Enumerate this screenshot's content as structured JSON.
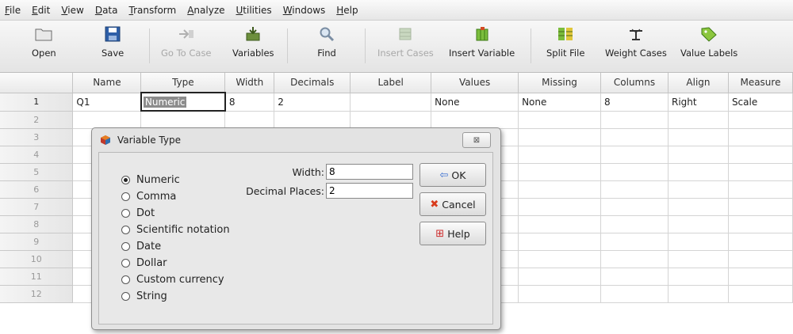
{
  "menu": [
    "File",
    "Edit",
    "View",
    "Data",
    "Transform",
    "Analyze",
    "Utilities",
    "Windows",
    "Help"
  ],
  "toolbar": {
    "open": "Open",
    "save": "Save",
    "go_to_case": "Go To Case",
    "variables": "Variables",
    "find": "Find",
    "insert_cases": "Insert Cases",
    "insert_variable": "Insert Variable",
    "split_file": "Split File",
    "weight_cases": "Weight Cases",
    "value_labels": "Value Labels"
  },
  "grid": {
    "columns": [
      "Name",
      "Type",
      "Width",
      "Decimals",
      "Label",
      "Values",
      "Missing",
      "Columns",
      "Align",
      "Measure"
    ],
    "row_numbers": [
      "1",
      "2",
      "3",
      "4",
      "5",
      "6",
      "7",
      "8",
      "9",
      "10",
      "11",
      "12"
    ],
    "row1": {
      "name": "Q1",
      "type": "Numeric",
      "width": "8",
      "decimals": "2",
      "label": "",
      "values": "None",
      "missing": "None",
      "columns": "8",
      "align": "Right",
      "measure": "Scale"
    }
  },
  "dialog": {
    "title": "Variable Type",
    "close_glyph": "⊠",
    "options": [
      "Numeric",
      "Comma",
      "Dot",
      "Scientific notation",
      "Date",
      "Dollar",
      "Custom currency",
      "String"
    ],
    "selected": "Numeric",
    "width_label": "Width:",
    "width_value": "8",
    "decimal_label": "Decimal Places:",
    "decimal_value": "2",
    "ok_label": "OK",
    "cancel_label": "Cancel",
    "help_label": "Help"
  },
  "colors": {
    "ok_icon": "#3a6fd1",
    "cancel_icon": "#d83b1c",
    "help_icon": "#cc2a2a"
  }
}
